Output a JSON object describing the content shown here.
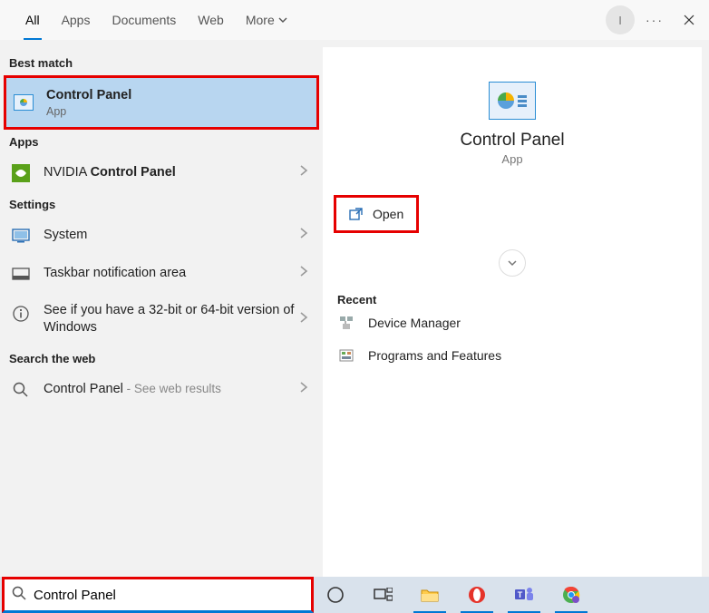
{
  "tabs": {
    "all": "All",
    "apps": "Apps",
    "documents": "Documents",
    "web": "Web",
    "more": "More"
  },
  "top": {
    "avatar_initial": "I"
  },
  "sections": {
    "best_match": "Best match",
    "apps": "Apps",
    "settings": "Settings",
    "search_web": "Search the web"
  },
  "results": {
    "cp": {
      "title": "Control Panel",
      "type": "App"
    },
    "nvidia": {
      "prefix": "NVIDIA ",
      "bold": "Control Panel"
    },
    "system": "System",
    "taskbar": "Taskbar notification area",
    "bits": "See if you have a 32-bit or 64-bit version of Windows",
    "web": {
      "title": "Control Panel",
      "suffix": " - See web results"
    }
  },
  "detail": {
    "title": "Control Panel",
    "type": "App",
    "open": "Open",
    "recent_label": "Recent",
    "recent": {
      "devmgr": "Device Manager",
      "progs": "Programs and Features"
    }
  },
  "search": {
    "value": "Control Panel"
  },
  "taskbar": {
    "cortana": "cortana",
    "taskview": "taskview",
    "explorer": "explorer",
    "opera": "opera",
    "teams": "teams",
    "chrome": "chrome"
  }
}
